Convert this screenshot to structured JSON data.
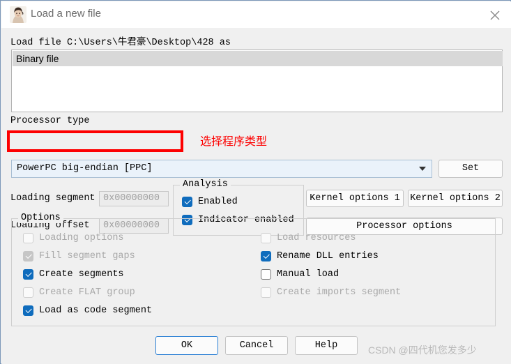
{
  "window": {
    "title": "Load a new file",
    "icon": "ida-woman-logo-icon",
    "close_label": "✕"
  },
  "file": {
    "load_file_line": "Load file C:\\Users\\牛君豪\\Desktop\\428 as",
    "filetypes": [
      {
        "label": "Binary file",
        "selected": true
      }
    ]
  },
  "processor": {
    "group_label": "Processor type",
    "selected": "PowerPC big-endian [PPC]",
    "set_label": "Set"
  },
  "annotation": {
    "note": "选择程序类型",
    "color": "#fd0000"
  },
  "loading": {
    "segment_label": "Loading segment",
    "segment_value": "0x00000000",
    "offset_label": "Loading offset",
    "offset_value": "0x00000000"
  },
  "analysis": {
    "title": "Analysis",
    "items": [
      {
        "label": "Enabled",
        "checked": true,
        "disabled": false
      },
      {
        "label": "Indicator enabled",
        "checked": true,
        "disabled": false
      }
    ]
  },
  "option_buttons": {
    "kernel1": "Kernel options 1",
    "kernel2": "Kernel options 2",
    "processor_options": "Processor options"
  },
  "options": {
    "title": "Options",
    "left_column": [
      {
        "label": "Loading options",
        "checked": false,
        "disabled": true
      },
      {
        "label": "Fill segment gaps",
        "checked": true,
        "disabled": true
      },
      {
        "label": "Create segments",
        "checked": true,
        "disabled": false
      },
      {
        "label": "Create FLAT group",
        "checked": false,
        "disabled": true
      },
      {
        "label": "Load as code segment",
        "checked": true,
        "disabled": false
      }
    ],
    "right_column": [
      {
        "label": "Load resources",
        "checked": false,
        "disabled": true
      },
      {
        "label": "Rename DLL entries",
        "checked": true,
        "disabled": false
      },
      {
        "label": "Manual load",
        "checked": false,
        "disabled": false
      },
      {
        "label": "Create imports segment",
        "checked": false,
        "disabled": true
      }
    ]
  },
  "footer": {
    "ok": "OK",
    "cancel": "Cancel",
    "help": "Help"
  },
  "watermark": "CSDN @四代机您发多少",
  "colors": {
    "accent_blue": "#0f6cbd",
    "annotation_red": "#fd0000",
    "dialog_bg": "#f0f0f0",
    "selection_gray": "#d8d8d8"
  }
}
